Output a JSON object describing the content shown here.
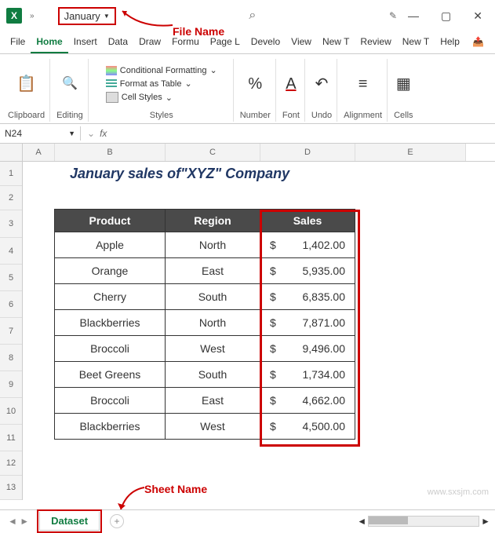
{
  "titlebar": {
    "file_name": "January",
    "search_icon": "⌕",
    "pen_icon": "✎"
  },
  "annotations": {
    "file_name_label": "File Name",
    "sheet_name_label": "Sheet Name"
  },
  "menu": {
    "items": [
      "File",
      "Home",
      "Insert",
      "Data",
      "Draw",
      "Formu",
      "Page L",
      "Develo",
      "View",
      "New T",
      "Review",
      "New T",
      "Help"
    ],
    "active": 1
  },
  "ribbon": {
    "clipboard": {
      "label": "Clipboard",
      "icon": "📋"
    },
    "editing": {
      "label": "Editing",
      "icon": "✎"
    },
    "styles": {
      "label": "Styles",
      "cf": "Conditional Formatting",
      "fat": "Format as Table",
      "cs": "Cell Styles"
    },
    "number": {
      "label": "Number",
      "icon": "%"
    },
    "font": {
      "label": "Font",
      "icon": "A"
    },
    "undo": {
      "label": "Undo",
      "icon": "↶"
    },
    "alignment": {
      "label": "Alignment",
      "icon": "≡"
    },
    "cells": {
      "label": "Cells",
      "icon": "☷"
    }
  },
  "name_box": {
    "value": "N24",
    "fx": "fx"
  },
  "columns": [
    "A",
    "B",
    "C",
    "D",
    "E"
  ],
  "rows": [
    "1",
    "2",
    "3",
    "4",
    "5",
    "6",
    "7",
    "8",
    "9",
    "10",
    "11",
    "12",
    "13"
  ],
  "sheet": {
    "title": "January sales of\"XYZ\" Company",
    "headers": {
      "product": "Product",
      "region": "Region",
      "sales": "Sales"
    },
    "data": [
      {
        "product": "Apple",
        "region": "North",
        "sales": "1,402.00"
      },
      {
        "product": "Orange",
        "region": "East",
        "sales": "5,935.00"
      },
      {
        "product": "Cherry",
        "region": "South",
        "sales": "6,835.00"
      },
      {
        "product": "Blackberries",
        "region": "North",
        "sales": "7,871.00"
      },
      {
        "product": "Broccoli",
        "region": "West",
        "sales": "9,496.00"
      },
      {
        "product": "Beet Greens",
        "region": "South",
        "sales": "1,734.00"
      },
      {
        "product": "Broccoli",
        "region": "East",
        "sales": "4,662.00"
      },
      {
        "product": "Blackberries",
        "region": "West",
        "sales": "4,500.00"
      }
    ],
    "currency": "$"
  },
  "tabs": {
    "sheet_name": "Dataset"
  },
  "watermark": "www.sxsjm.com"
}
